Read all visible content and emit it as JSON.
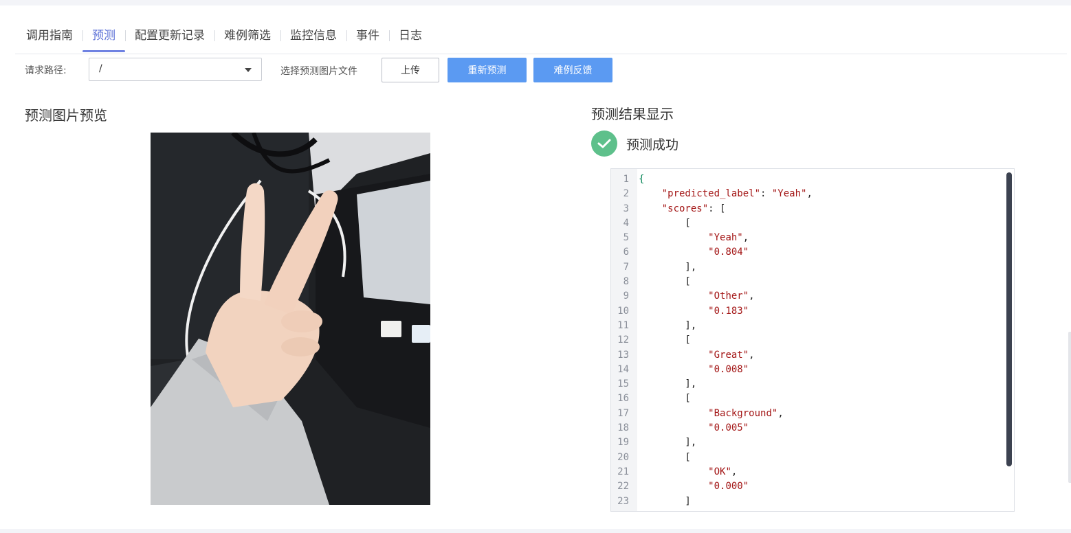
{
  "tabs": [
    {
      "label": "调用指南",
      "active": false
    },
    {
      "label": "预测",
      "active": true
    },
    {
      "label": "配置更新记录",
      "active": false
    },
    {
      "label": "难例筛选",
      "active": false
    },
    {
      "label": "监控信息",
      "active": false
    },
    {
      "label": "事件",
      "active": false
    },
    {
      "label": "日志",
      "active": false
    }
  ],
  "toolbar": {
    "path_label": "请求路径:",
    "path_value": "/",
    "file_label": "选择预测图片文件",
    "upload_label": "上传",
    "repredict_label": "重新预测",
    "feedback_label": "难例反馈"
  },
  "preview": {
    "title": "预测图片预览"
  },
  "result": {
    "title": "预测结果显示",
    "status": "预测成功",
    "code_lines": [
      "{",
      "    \"predicted_label\": \"Yeah\",",
      "    \"scores\": [",
      "        [",
      "            \"Yeah\",",
      "            \"0.804\"",
      "        ],",
      "        [",
      "            \"Other\",",
      "            \"0.183\"",
      "        ],",
      "        [",
      "            \"Great\",",
      "            \"0.008\"",
      "        ],",
      "        [",
      "            \"Background\",",
      "            \"0.005\"",
      "        ],",
      "        [",
      "            \"OK\",",
      "            \"0.000\"",
      "        ]"
    ]
  },
  "colors": {
    "accent": "#5b9af2",
    "tab_active": "#5a6fd6",
    "success": "#5ec08b"
  }
}
